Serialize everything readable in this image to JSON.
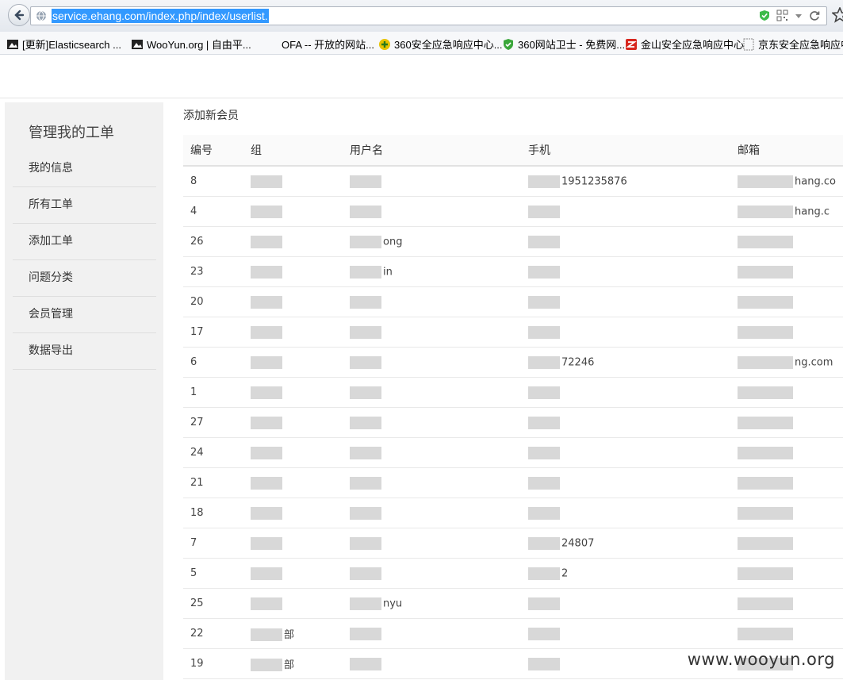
{
  "browser": {
    "url": "service.ehang.com/index.php/index/userlist.",
    "bookmarks": [
      {
        "label": "[更新]Elasticsearch ...",
        "icon": "bookmark-icon"
      },
      {
        "label": "WooYun.org | 自由平...",
        "icon": "wooyun-icon"
      },
      {
        "label": "OFA -- 开放的网站...",
        "icon": "bookmark-icon"
      },
      {
        "label": "360安全应急响应中心...",
        "icon": "360-icon"
      },
      {
        "label": "360网站卫士 - 免费网...",
        "icon": "shield-icon"
      },
      {
        "label": "金山安全应急响应中心",
        "icon": "kingsoft-icon"
      },
      {
        "label": "京东安全应急响应中",
        "icon": "page-icon"
      }
    ]
  },
  "sidebar": {
    "title": "管理我的工单",
    "items": [
      {
        "label": "我的信息"
      },
      {
        "label": "所有工单"
      },
      {
        "label": "添加工单"
      },
      {
        "label": "问题分类"
      },
      {
        "label": "会员管理"
      },
      {
        "label": "数据导出"
      }
    ]
  },
  "main": {
    "add_member": "添加新会员",
    "columns": [
      "编号",
      "组",
      "用户名",
      "手机",
      "邮箱"
    ],
    "rows": [
      {
        "id": "8",
        "group": "",
        "username": "",
        "phone": "1951235876",
        "email": "hang.co"
      },
      {
        "id": "4",
        "group": "",
        "username": "",
        "phone": "",
        "email": "hang.c"
      },
      {
        "id": "26",
        "group": "",
        "username": "ong",
        "phone": "",
        "email": ""
      },
      {
        "id": "23",
        "group": "",
        "username": "in",
        "phone": "",
        "email": ""
      },
      {
        "id": "20",
        "group": "",
        "username": "",
        "phone": "",
        "email": ""
      },
      {
        "id": "17",
        "group": "",
        "username": "",
        "phone": "",
        "email": ""
      },
      {
        "id": "6",
        "group": "",
        "username": "",
        "phone": "72246",
        "email": "ng.com"
      },
      {
        "id": "1",
        "group": "",
        "username": "",
        "phone": "",
        "email": ""
      },
      {
        "id": "27",
        "group": "",
        "username": "",
        "phone": "",
        "email": ""
      },
      {
        "id": "24",
        "group": "",
        "username": "",
        "phone": "",
        "email": ""
      },
      {
        "id": "21",
        "group": "",
        "username": "",
        "phone": "",
        "email": ""
      },
      {
        "id": "18",
        "group": "",
        "username": "",
        "phone": "",
        "email": ""
      },
      {
        "id": "7",
        "group": "",
        "username": "",
        "phone": "24807",
        "email": ""
      },
      {
        "id": "5",
        "group": "",
        "username": "",
        "phone": "2",
        "email": ""
      },
      {
        "id": "25",
        "group": "",
        "username": "nyu",
        "phone": "",
        "email": ""
      },
      {
        "id": "22",
        "group": "部",
        "username": "",
        "phone": "",
        "email": ""
      },
      {
        "id": "19",
        "group": "部",
        "username": "",
        "phone": "",
        "email": ""
      }
    ]
  },
  "watermark": "www.wooyun.org"
}
